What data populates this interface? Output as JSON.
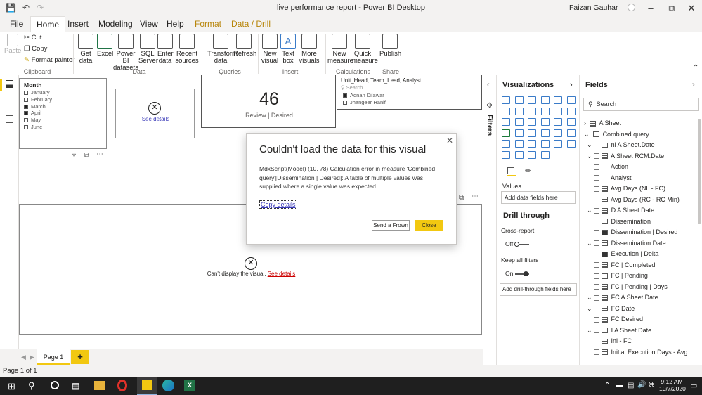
{
  "window": {
    "title": "live performance report - Power BI Desktop",
    "user": "Faizan Gauhar"
  },
  "tabs": [
    "File",
    "Home",
    "Insert",
    "Modeling",
    "View",
    "Help",
    "Format",
    "Data / Drill"
  ],
  "ribbon": {
    "clipboard": {
      "paste": "Paste",
      "cut": "Cut",
      "copy": "Copy",
      "format_painter": "Format painter",
      "group": "Clipboard"
    },
    "data": {
      "get_data": "Get data",
      "excel": "Excel",
      "pbi_datasets": "Power BI datasets",
      "sql": "SQL Server",
      "enter_data": "Enter data",
      "recent": "Recent sources",
      "group": "Data"
    },
    "queries": {
      "transform": "Transform data",
      "refresh": "Refresh",
      "group": "Queries"
    },
    "insert": {
      "new_visual": "New visual",
      "text_box": "Text box",
      "more": "More visuals",
      "group": "Insert"
    },
    "calc": {
      "new_measure": "New measure",
      "quick_measure": "Quick measure",
      "group": "Calculations"
    },
    "share": {
      "publish": "Publish",
      "group": "Share"
    }
  },
  "slicer": {
    "title": "Month",
    "items": [
      {
        "label": "January",
        "checked": false
      },
      {
        "label": "February",
        "checked": false
      },
      {
        "label": "March",
        "checked": true
      },
      {
        "label": "April",
        "checked": true
      },
      {
        "label": "May",
        "checked": false
      },
      {
        "label": "June",
        "checked": false
      }
    ]
  },
  "error_card": {
    "link": "See details"
  },
  "kpi": {
    "value": "46",
    "label": "Review | Desired"
  },
  "slicer2": {
    "title": "Unit_Head, Team_Lead, Analyst",
    "search": "Search",
    "items": [
      {
        "label": "Adnan Dilawar",
        "checked": true
      },
      {
        "label": "Jhangeer Hanif",
        "checked": false
      }
    ]
  },
  "big_visual": {
    "message": "Can't display the visual.",
    "link": "See details"
  },
  "dialog": {
    "title": "Couldn't load the data for this visual",
    "body": "MdxScript(Model) (10, 78) Calculation error in measure 'Combined query'[Dissemination | Desired]: A table of multiple values was supplied where a single value was expected.",
    "copy": "Copy details",
    "frown": "Send a Frown",
    "close": "Close"
  },
  "filters_label": "Filters",
  "viz": {
    "title": "Visualizations",
    "values_tab": "Values",
    "add_fields": "Add data fields here",
    "drill": "Drill through",
    "cross_report": "Cross-report",
    "cross_state": "Off",
    "keep_filters": "Keep all filters",
    "keep_state": "On",
    "add_drill": "Add drill-through fields here"
  },
  "fields": {
    "title": "Fields",
    "search": "Search",
    "items": [
      {
        "label": "A Sheet",
        "kind": "table",
        "indent": 0
      },
      {
        "label": "Combined query",
        "kind": "table",
        "indent": 0
      },
      {
        "label": "nl A Sheet.Date",
        "kind": "date",
        "indent": 1
      },
      {
        "label": "A Sheet RCM.Date",
        "kind": "date",
        "indent": 1
      },
      {
        "label": "Action",
        "kind": "field",
        "indent": 2
      },
      {
        "label": "Analyst",
        "kind": "field",
        "indent": 2
      },
      {
        "label": "Avg Days (NL - FC)",
        "kind": "measure",
        "indent": 2
      },
      {
        "label": "Avg Days (RC - RC Min)",
        "kind": "measure",
        "indent": 2
      },
      {
        "label": "D A Sheet.Date",
        "kind": "date",
        "indent": 1
      },
      {
        "label": "Dissemination",
        "kind": "measure",
        "indent": 2
      },
      {
        "label": "Dissemination | Desired",
        "kind": "calc",
        "indent": 2
      },
      {
        "label": "Dissemination Date",
        "kind": "date",
        "indent": 1
      },
      {
        "label": "Execution | Delta",
        "kind": "calc",
        "indent": 2
      },
      {
        "label": "FC | Completed",
        "kind": "measure",
        "indent": 2
      },
      {
        "label": "FC | Pending",
        "kind": "measure",
        "indent": 2
      },
      {
        "label": "FC | Pending | Days",
        "kind": "measure",
        "indent": 2
      },
      {
        "label": "FC A Sheet.Date",
        "kind": "date",
        "indent": 1
      },
      {
        "label": "FC Date",
        "kind": "date",
        "indent": 1
      },
      {
        "label": "FC Desired",
        "kind": "measure",
        "indent": 2
      },
      {
        "label": "I A Sheet.Date",
        "kind": "date",
        "indent": 1
      },
      {
        "label": "Ini - FC",
        "kind": "measure",
        "indent": 2
      },
      {
        "label": "Initial Execution Days - Avg",
        "kind": "measure",
        "indent": 2
      }
    ]
  },
  "pages": {
    "current": "Page 1",
    "add": "+"
  },
  "status": "Page 1 of 1",
  "taskbar": {
    "time": "9:12 AM",
    "date": "10/7/2020"
  },
  "colors": {
    "accent": "#f2c811",
    "brand_yellow": "#b8860b",
    "link": "#3a3ab8"
  }
}
